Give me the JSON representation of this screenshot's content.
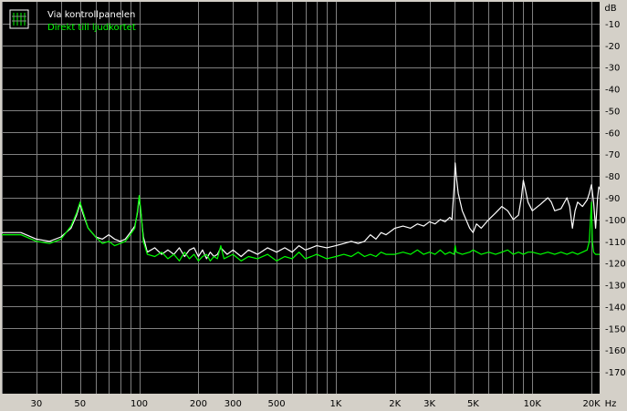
{
  "chart_data": {
    "type": "line",
    "title": "",
    "xlabel": "",
    "ylabel": "",
    "x_unit": "Hz",
    "y_unit": "dB",
    "x_scale": "log",
    "xlim": [
      20,
      22000
    ],
    "ylim": [
      -180,
      0
    ],
    "grid": true,
    "legend_position": "top-left",
    "background_color": "#000000",
    "grid_color": "#808080",
    "x_ticks": [
      {
        "value": 30,
        "label": "30"
      },
      {
        "value": 50,
        "label": "50"
      },
      {
        "value": 100,
        "label": "100"
      },
      {
        "value": 200,
        "label": "200"
      },
      {
        "value": 300,
        "label": "300"
      },
      {
        "value": 500,
        "label": "500"
      },
      {
        "value": 1000,
        "label": "1K"
      },
      {
        "value": 2000,
        "label": "2K"
      },
      {
        "value": 3000,
        "label": "3K"
      },
      {
        "value": 5000,
        "label": "5K"
      },
      {
        "value": 10000,
        "label": "10K"
      },
      {
        "value": 20000,
        "label": "20K"
      }
    ],
    "y_ticks": [
      {
        "value": -10,
        "label": "-10"
      },
      {
        "value": -20,
        "label": "-20"
      },
      {
        "value": -30,
        "label": "-30"
      },
      {
        "value": -40,
        "label": "-40"
      },
      {
        "value": -50,
        "label": "-50"
      },
      {
        "value": -60,
        "label": "-60"
      },
      {
        "value": -70,
        "label": "-70"
      },
      {
        "value": -80,
        "label": "-80"
      },
      {
        "value": -90,
        "label": "-90"
      },
      {
        "value": -100,
        "label": "-100"
      },
      {
        "value": -110,
        "label": "-110"
      },
      {
        "value": -120,
        "label": "-120"
      },
      {
        "value": -130,
        "label": "-130"
      },
      {
        "value": -140,
        "label": "-140"
      },
      {
        "value": -150,
        "label": "-150"
      },
      {
        "value": -160,
        "label": "-160"
      },
      {
        "value": -170,
        "label": "-170"
      }
    ],
    "series": [
      {
        "name": "Via kontrollpanelen",
        "color": "#ffffff",
        "points": [
          [
            20,
            -106
          ],
          [
            25,
            -106
          ],
          [
            30,
            -109
          ],
          [
            35,
            -110
          ],
          [
            40,
            -108
          ],
          [
            45,
            -104
          ],
          [
            48,
            -98
          ],
          [
            50,
            -93
          ],
          [
            52,
            -98
          ],
          [
            55,
            -104
          ],
          [
            60,
            -108
          ],
          [
            65,
            -109
          ],
          [
            70,
            -107
          ],
          [
            75,
            -109
          ],
          [
            80,
            -110
          ],
          [
            85,
            -109
          ],
          [
            90,
            -106
          ],
          [
            95,
            -103
          ],
          [
            98,
            -97
          ],
          [
            100,
            -90
          ],
          [
            102,
            -97
          ],
          [
            105,
            -108
          ],
          [
            110,
            -115
          ],
          [
            120,
            -113
          ],
          [
            130,
            -116
          ],
          [
            140,
            -114
          ],
          [
            150,
            -116
          ],
          [
            160,
            -113
          ],
          [
            170,
            -117
          ],
          [
            180,
            -114
          ],
          [
            190,
            -113
          ],
          [
            200,
            -117
          ],
          [
            210,
            -114
          ],
          [
            220,
            -118
          ],
          [
            230,
            -115
          ],
          [
            240,
            -117
          ],
          [
            250,
            -116
          ],
          [
            260,
            -113
          ],
          [
            280,
            -116
          ],
          [
            300,
            -114
          ],
          [
            330,
            -117
          ],
          [
            360,
            -114
          ],
          [
            400,
            -116
          ],
          [
            450,
            -113
          ],
          [
            500,
            -115
          ],
          [
            550,
            -113
          ],
          [
            600,
            -115
          ],
          [
            650,
            -112
          ],
          [
            700,
            -114
          ],
          [
            750,
            -113
          ],
          [
            800,
            -112
          ],
          [
            900,
            -113
          ],
          [
            1000,
            -112
          ],
          [
            1100,
            -111
          ],
          [
            1200,
            -110
          ],
          [
            1300,
            -111
          ],
          [
            1400,
            -110
          ],
          [
            1500,
            -107
          ],
          [
            1600,
            -109
          ],
          [
            1700,
            -106
          ],
          [
            1800,
            -107
          ],
          [
            2000,
            -104
          ],
          [
            2200,
            -103
          ],
          [
            2400,
            -104
          ],
          [
            2600,
            -102
          ],
          [
            2800,
            -103
          ],
          [
            3000,
            -101
          ],
          [
            3200,
            -102
          ],
          [
            3400,
            -100
          ],
          [
            3600,
            -101
          ],
          [
            3800,
            -99
          ],
          [
            3900,
            -100
          ],
          [
            4000,
            -85
          ],
          [
            4050,
            -74
          ],
          [
            4100,
            -80
          ],
          [
            4200,
            -88
          ],
          [
            4400,
            -96
          ],
          [
            4600,
            -100
          ],
          [
            4800,
            -104
          ],
          [
            5000,
            -106
          ],
          [
            5200,
            -102
          ],
          [
            5500,
            -104
          ],
          [
            6000,
            -100
          ],
          [
            6500,
            -97
          ],
          [
            7000,
            -94
          ],
          [
            7500,
            -96
          ],
          [
            8000,
            -100
          ],
          [
            8500,
            -98
          ],
          [
            8800,
            -90
          ],
          [
            9000,
            -82
          ],
          [
            9200,
            -86
          ],
          [
            9500,
            -92
          ],
          [
            10000,
            -96
          ],
          [
            11000,
            -93
          ],
          [
            12000,
            -90
          ],
          [
            12500,
            -92
          ],
          [
            13000,
            -96
          ],
          [
            14000,
            -95
          ],
          [
            15000,
            -90
          ],
          [
            15500,
            -94
          ],
          [
            16000,
            -104
          ],
          [
            16500,
            -96
          ],
          [
            17000,
            -92
          ],
          [
            18000,
            -94
          ],
          [
            19000,
            -91
          ],
          [
            19500,
            -88
          ],
          [
            20000,
            -84
          ],
          [
            20500,
            -92
          ],
          [
            21000,
            -104
          ],
          [
            21500,
            -90
          ],
          [
            21800,
            -85
          ],
          [
            22000,
            -86
          ]
        ]
      },
      {
        "name": "Direkt till ljudkortet",
        "color": "#00ff00",
        "points": [
          [
            20,
            -107
          ],
          [
            25,
            -107
          ],
          [
            30,
            -110
          ],
          [
            35,
            -111
          ],
          [
            40,
            -109
          ],
          [
            45,
            -103
          ],
          [
            48,
            -97
          ],
          [
            50,
            -92
          ],
          [
            52,
            -97
          ],
          [
            55,
            -104
          ],
          [
            60,
            -108
          ],
          [
            65,
            -111
          ],
          [
            70,
            -110
          ],
          [
            75,
            -112
          ],
          [
            80,
            -111
          ],
          [
            85,
            -110
          ],
          [
            90,
            -107
          ],
          [
            95,
            -104
          ],
          [
            98,
            -96
          ],
          [
            100,
            -89
          ],
          [
            102,
            -96
          ],
          [
            105,
            -110
          ],
          [
            110,
            -116
          ],
          [
            120,
            -117
          ],
          [
            130,
            -115
          ],
          [
            140,
            -118
          ],
          [
            150,
            -116
          ],
          [
            160,
            -119
          ],
          [
            170,
            -115
          ],
          [
            180,
            -118
          ],
          [
            190,
            -116
          ],
          [
            200,
            -119
          ],
          [
            210,
            -117
          ],
          [
            220,
            -116
          ],
          [
            230,
            -119
          ],
          [
            240,
            -117
          ],
          [
            250,
            -118
          ],
          [
            260,
            -112
          ],
          [
            270,
            -118
          ],
          [
            300,
            -116
          ],
          [
            330,
            -119
          ],
          [
            360,
            -117
          ],
          [
            400,
            -118
          ],
          [
            450,
            -116
          ],
          [
            500,
            -119
          ],
          [
            550,
            -117
          ],
          [
            600,
            -118
          ],
          [
            650,
            -115
          ],
          [
            700,
            -118
          ],
          [
            750,
            -117
          ],
          [
            800,
            -116
          ],
          [
            900,
            -118
          ],
          [
            1000,
            -117
          ],
          [
            1100,
            -116
          ],
          [
            1200,
            -117
          ],
          [
            1300,
            -115
          ],
          [
            1400,
            -117
          ],
          [
            1500,
            -116
          ],
          [
            1600,
            -117
          ],
          [
            1700,
            -115
          ],
          [
            1800,
            -116
          ],
          [
            2000,
            -116
          ],
          [
            2200,
            -115
          ],
          [
            2400,
            -116
          ],
          [
            2600,
            -114
          ],
          [
            2800,
            -116
          ],
          [
            3000,
            -115
          ],
          [
            3200,
            -116
          ],
          [
            3400,
            -114
          ],
          [
            3600,
            -116
          ],
          [
            3800,
            -115
          ],
          [
            4000,
            -116
          ],
          [
            4050,
            -112
          ],
          [
            4100,
            -115
          ],
          [
            4400,
            -116
          ],
          [
            4800,
            -115
          ],
          [
            5000,
            -114
          ],
          [
            5500,
            -116
          ],
          [
            6000,
            -115
          ],
          [
            6500,
            -116
          ],
          [
            7000,
            -115
          ],
          [
            7500,
            -114
          ],
          [
            8000,
            -116
          ],
          [
            8500,
            -115
          ],
          [
            9000,
            -116
          ],
          [
            9500,
            -115
          ],
          [
            10000,
            -115
          ],
          [
            11000,
            -116
          ],
          [
            12000,
            -115
          ],
          [
            13000,
            -116
          ],
          [
            14000,
            -115
          ],
          [
            15000,
            -116
          ],
          [
            16000,
            -115
          ],
          [
            17000,
            -116
          ],
          [
            18000,
            -115
          ],
          [
            19000,
            -114
          ],
          [
            19500,
            -110
          ],
          [
            20000,
            -92
          ],
          [
            20200,
            -110
          ],
          [
            20500,
            -115
          ],
          [
            21000,
            -116
          ],
          [
            22000,
            -116
          ]
        ]
      }
    ]
  }
}
